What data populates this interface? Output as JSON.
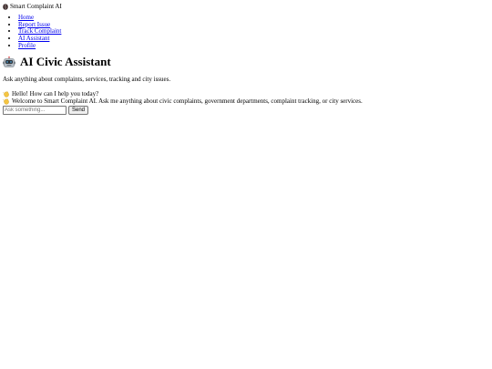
{
  "brand": {
    "name": "Smart Complaint AI",
    "icon": "brain-icon"
  },
  "nav": {
    "items": [
      {
        "label": "Home"
      },
      {
        "label": "Report Issue"
      },
      {
        "label": "Track Complaint"
      },
      {
        "label": "AI Assistant"
      },
      {
        "label": "Profile"
      }
    ]
  },
  "main": {
    "title": "AI Civic Assistant",
    "title_icon": "robot-icon",
    "subtitle": "Ask anything about complaints, services, tracking and city issues."
  },
  "chat": {
    "messages": [
      {
        "icon": "waving-hand-icon",
        "text": "Hello! How can I help you today?"
      },
      {
        "icon": "waving-hand-icon",
        "text": "Welcome to Smart Complaint AI. Ask me anything about civic complaints, government departments, complaint tracking, or city services."
      }
    ],
    "input_value": "",
    "input_placeholder": "Ask something...",
    "send_label": "Send"
  }
}
